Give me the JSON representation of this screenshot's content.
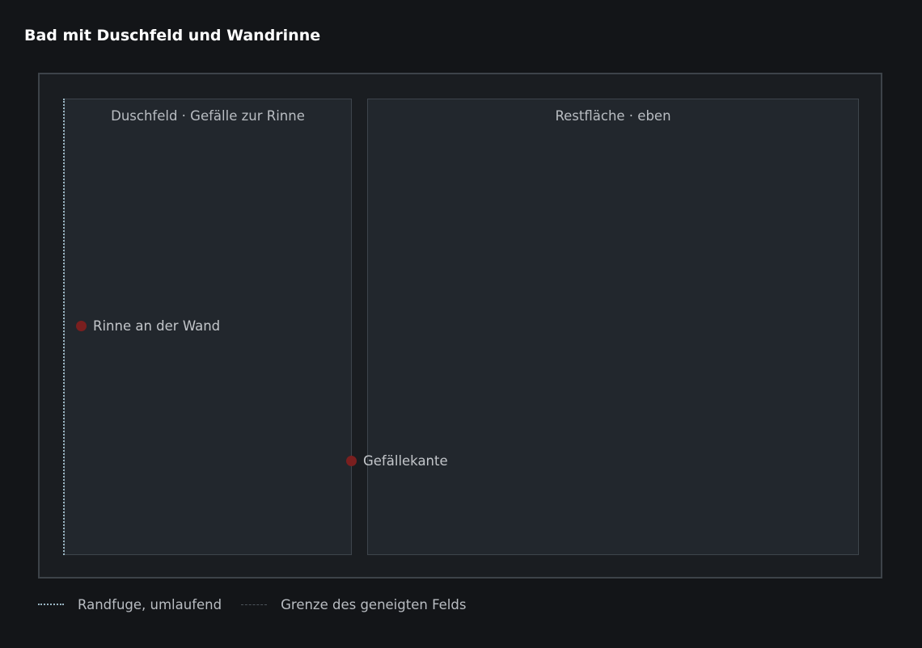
{
  "title": "Bad mit Duschfeld und Wandrinne",
  "zones": {
    "shower": {
      "label": "Duschfeld · Gefälle zur Rinne"
    },
    "rest": {
      "label": "Restfläche · eben"
    }
  },
  "markers": {
    "drain": {
      "label": "Rinne an der Wand"
    },
    "slope_edge": {
      "label": "Gefällekante"
    }
  },
  "legend": {
    "perimeter_joint": "Randfuge, umlaufend",
    "sloped_field_boundary": "Grenze des geneigten Felds"
  },
  "colors": {
    "background": "#131518",
    "room": "#1a1d21",
    "zone_fill": "#22272d",
    "zone_border": "#3e454c",
    "joint": "#9bb7c4",
    "marker": "#7a1f1f",
    "text": "#b9bdc2"
  }
}
